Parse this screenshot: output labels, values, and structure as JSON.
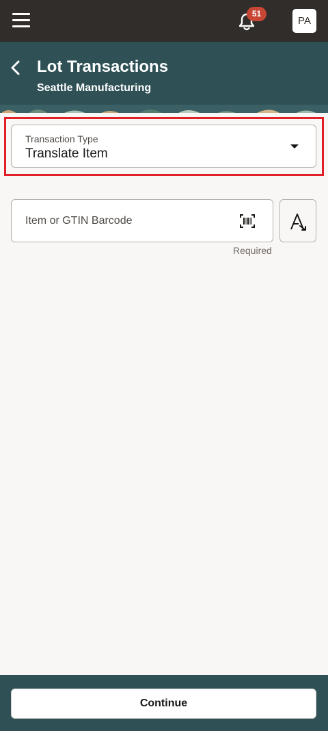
{
  "topbar": {
    "notification_count": "51",
    "user_initials": "PA"
  },
  "header": {
    "title": "Lot Transactions",
    "subtitle": "Seattle Manufacturing"
  },
  "form": {
    "transaction_type": {
      "label": "Transaction Type",
      "value": "Translate Item"
    },
    "item": {
      "placeholder": "Item or GTIN Barcode",
      "value": "",
      "helper": "Required"
    }
  },
  "footer": {
    "continue_label": "Continue"
  },
  "icons": {
    "menu": "hamburger-menu-icon",
    "notifications": "bell-icon",
    "back": "chevron-left-icon",
    "dropdown": "caret-down-icon",
    "barcode": "barcode-scan-icon",
    "text_entry": "text-entry-icon"
  },
  "colors": {
    "topbar": "#312d2a",
    "header": "#2f5156",
    "badge": "#c74634",
    "highlight": "#e11f26",
    "background": "#f9f7f5"
  }
}
